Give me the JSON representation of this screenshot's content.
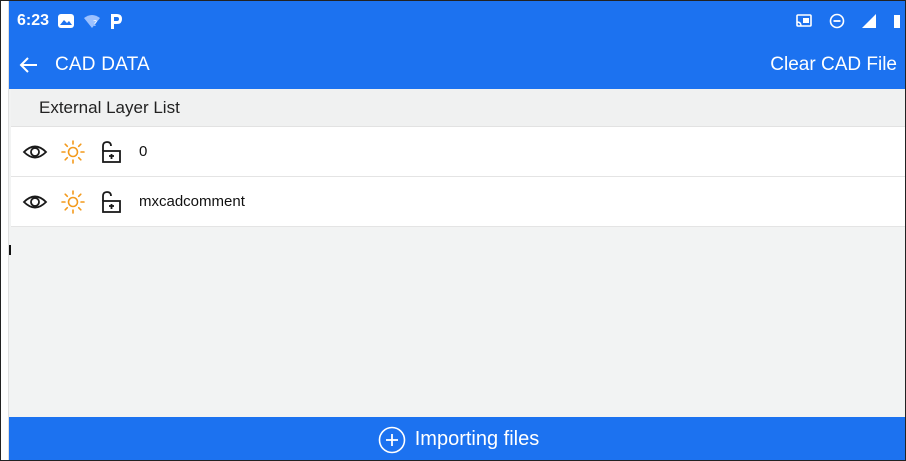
{
  "status_bar": {
    "time": "6:23",
    "left_icons": [
      "photos-icon",
      "wifi-icon",
      "p-icon"
    ],
    "right_icons": [
      "cast-icon",
      "do-not-disturb-icon",
      "signal-icon",
      "battery-icon"
    ]
  },
  "app_bar": {
    "title": "CAD DATA",
    "clear_label": "Clear CAD File"
  },
  "list": {
    "header": "External Layer List",
    "layers": [
      {
        "name": "0",
        "icons": [
          "eye-icon",
          "sun-icon",
          "unlock-icon"
        ]
      },
      {
        "name": "mxcadcomment",
        "icons": [
          "eye-icon",
          "sun-icon",
          "unlock-icon"
        ]
      }
    ]
  },
  "bottom_bar": {
    "import_label": "Importing files"
  },
  "colors": {
    "primary": "#1c72f0",
    "sun": "#f39a1c",
    "list_bg": "#f2f3f3",
    "text": "#111111"
  }
}
